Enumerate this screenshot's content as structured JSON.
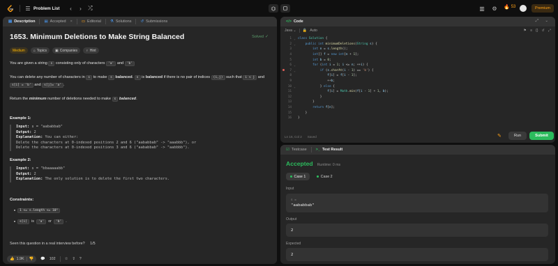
{
  "topbar": {
    "title": "Problem List",
    "streak": "53",
    "premium": "Premium"
  },
  "desc_tabs": [
    {
      "label": "Description"
    },
    {
      "label": "Accepted"
    },
    {
      "label": "Editorial"
    },
    {
      "label": "Solutions"
    },
    {
      "label": "Submissions"
    }
  ],
  "problem": {
    "title": "1653. Minimum Deletions to Make String Balanced",
    "status": "Solved",
    "difficulty": "Medium",
    "tags": [
      "Topics",
      "Companies",
      "Hint"
    ],
    "p1_a": "You are given a string",
    "p1_s": "s",
    "p1_b": "consisting only of characters",
    "p1_ca": "'a'",
    "p1_and": "and",
    "p1_cb": "'b'",
    "p2_a": "You can delete any number of characters in",
    "p2_s": "s",
    "p2_b": "to make",
    "p2_s2": "s",
    "p2_bal": "balanced",
    "p2_c": ".",
    "p2_s3": "s",
    "p2_d": "is",
    "p2_bal2": "balanced",
    "p2_e": "if there is no pair of indices",
    "p2_ij": "(i,j)",
    "p2_f": "such that",
    "p2_ilj": "i < j",
    "p2_and": "and",
    "p2_si": "s[i] = 'b'",
    "p2_and2": "and",
    "p2_sj": "s[j]= 'a'",
    "p2_end": ".",
    "p3_a": "Return the",
    "p3_min": "minimum",
    "p3_b": "number of deletions needed to make",
    "p3_s": "s",
    "p3_bal": "balanced",
    "p3_end": "."
  },
  "examples": [
    {
      "title": "Example 1:",
      "input_label": "Input:",
      "input": "s = \"aababbab\"",
      "output_label": "Output:",
      "output": "2",
      "expl_label": "Explanation:",
      "expl": "You can either:",
      "lines": [
        "Delete the characters at 0-indexed positions 2 and 6 (\"aababbab\" -> \"aaabbb\"), or",
        "Delete the characters at 0-indexed positions 3 and 6 (\"aababbab\" -> \"aabbbb\")."
      ]
    },
    {
      "title": "Example 2:",
      "input_label": "Input:",
      "input": "s = \"bbaaaaabb\"",
      "output_label": "Output:",
      "output": "2",
      "expl_label": "Explanation:",
      "expl": "The only solution is to delete the first two characters.",
      "lines": []
    }
  ],
  "constraints": {
    "title": "Constraints:",
    "c1": "1 <= s.length <= 10⁵",
    "c2_code": "s[i]",
    "c2_is": "is",
    "c2_a": "'a'",
    "c2_or": "or",
    "c2_b": "'b'",
    "c2_end": "."
  },
  "seen": {
    "question": "Seen this question in a real interview before?",
    "progress": "1/5"
  },
  "desc_footer": {
    "likes": "1.9K",
    "comments": "102"
  },
  "code_panel": {
    "title": "Code",
    "language": "Java",
    "mode": "Auto",
    "cursor": "Ln 16, Col 2",
    "saved": "Saved",
    "run": "Run",
    "submit": "Submit",
    "line_numbers": [
      "1",
      "2",
      "3",
      "4",
      "5",
      "6",
      "7",
      "8",
      "9",
      "10",
      "11",
      "12",
      "13",
      "14",
      "15",
      "16"
    ]
  },
  "result_panel": {
    "tab_testcase": "Testcase",
    "tab_result": "Test Result",
    "status": "Accepted",
    "runtime": "Runtime: 0 ms",
    "case1": "Case 1",
    "case2": "Case 2",
    "input_label": "Input",
    "input_var": "s =",
    "input_value": "\"aababbab\"",
    "output_label": "Output",
    "output_value": "2",
    "expected_label": "Expected",
    "expected_value": "2"
  },
  "colors": {
    "accent_green": "#2cbb5d",
    "accent_orange": "#ffa116",
    "medium": "#ffb800"
  }
}
